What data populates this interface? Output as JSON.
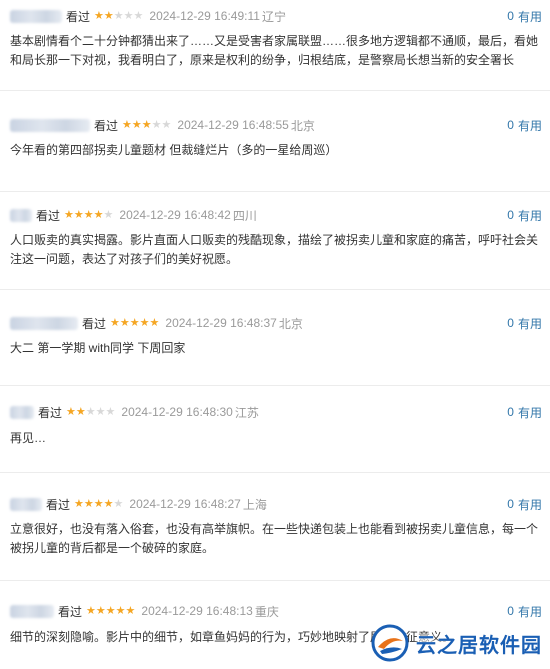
{
  "reviews": [
    {
      "seen": "看过",
      "rating": 2,
      "time": "2024-12-29 16:49:11",
      "location": "辽宁",
      "useful_count": "0",
      "useful_label": "有用",
      "content": "基本剧情看个二十分钟都猜出来了……又是受害者家属联盟……很多地方逻辑都不通顺，最后，看她和局长那一下对视，我看明白了，原来是权利的纷争，归根结底，是警察局长想当新的安全署长"
    },
    {
      "seen": "看过",
      "rating": 3,
      "time": "2024-12-29 16:48:55",
      "location": "北京",
      "useful_count": "0",
      "useful_label": "有用",
      "content": "今年看的第四部拐卖儿童题材 但裁缝烂片（多的一星给周巡）"
    },
    {
      "seen": "看过",
      "rating": 4,
      "time": "2024-12-29 16:48:42",
      "location": "四川",
      "useful_count": "0",
      "useful_label": "有用",
      "content": "人口贩卖的真实揭露。影片直面人口贩卖的残酷现象，描绘了被拐卖儿童和家庭的痛苦，呼吁社会关注这一问题，表达了对孩子们的美好祝愿。"
    },
    {
      "seen": "看过",
      "rating": 5,
      "time": "2024-12-29 16:48:37",
      "location": "北京",
      "useful_count": "0",
      "useful_label": "有用",
      "content": "大二 第一学期 with同学 下周回家"
    },
    {
      "seen": "看过",
      "rating": 2,
      "time": "2024-12-29 16:48:30",
      "location": "江苏",
      "useful_count": "0",
      "useful_label": "有用",
      "content": "再见…"
    },
    {
      "seen": "看过",
      "rating": 4,
      "time": "2024-12-29 16:48:27",
      "location": "上海",
      "useful_count": "0",
      "useful_label": "有用",
      "content": "立意很好，也没有落入俗套，也没有高举旗帜。在一些快递包装上也能看到被拐卖儿童信息，每一个被拐儿童的背后都是一个破碎的家庭。"
    },
    {
      "seen": "看过",
      "rating": 5,
      "time": "2024-12-29 16:48:13",
      "location": "重庆",
      "useful_count": "0",
      "useful_label": "有用",
      "content": "细节的深刻隐喻。影片中的细节，如章鱼妈妈的行为，巧妙地映射了层的象征意义。"
    }
  ],
  "watermark": {
    "text": "云之居软件园"
  },
  "colors": {
    "star_on": "#f5a623",
    "star_off": "#d8d8d8",
    "link": "#3377aa",
    "meta": "#9a9a9a"
  }
}
